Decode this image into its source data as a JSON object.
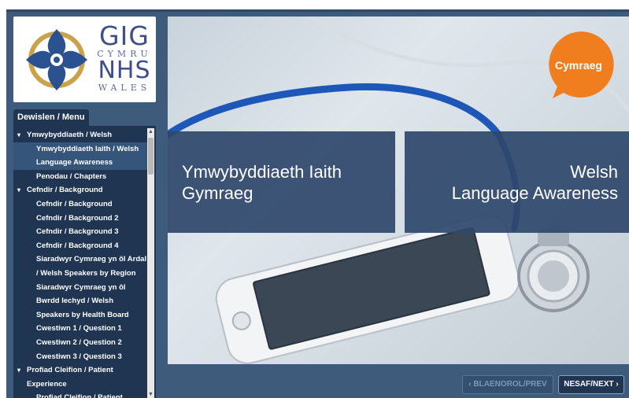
{
  "logo": {
    "line1": "GIG",
    "line2": "CYMRU",
    "line3": "NHS",
    "line4": "WALES"
  },
  "menu": {
    "tab_label": "Dewislen / Menu",
    "items": [
      {
        "label": "Ymwybyddiaeth / Welsh",
        "caret": "▾"
      },
      {
        "label": "Ymwybyddiaeth Iaith / Welsh"
      },
      {
        "label": "Language Awareness"
      },
      {
        "label": "Penodau / Chapters"
      },
      {
        "label": "Cefndir / Background",
        "caret": "▾"
      },
      {
        "label": "Cefndir / Background"
      },
      {
        "label": "Cefndir / Background 2"
      },
      {
        "label": "Cefndir / Background 3"
      },
      {
        "label": "Cefndir / Background 4"
      },
      {
        "label": "Siaradwyr Cymraeg yn ôl Ardal"
      },
      {
        "label": "/ Welsh Speakers by Region"
      },
      {
        "label": "Siaradwyr Cymraeg yn ôl"
      },
      {
        "label": "Bwrdd Iechyd / Welsh"
      },
      {
        "label": "Speakers by Health Board"
      },
      {
        "label": "Cwestiwn 1 / Question 1"
      },
      {
        "label": "Cwestiwn 2 / Question 2"
      },
      {
        "label": "Cwestiwn 3 / Question 3"
      },
      {
        "label": "Profiad Cleifion / Patient",
        "caret": "▾"
      },
      {
        "label": "Experience"
      },
      {
        "label": "Profiad Cleifion / Patient"
      }
    ],
    "scroll_up": "▲",
    "scroll_down": "▼"
  },
  "slide": {
    "badge": "Cymraeg",
    "title_welsh_line1": "Ymwybyddiaeth Iaith",
    "title_welsh_line2": "Gymraeg",
    "title_english_line1": "Welsh",
    "title_english_line2": "Language Awareness"
  },
  "nav": {
    "prev_label": "‹ BLAENOROL/PREV",
    "next_label": "NESAF/NEXT ›"
  },
  "colors": {
    "frame": "#3e5b7b",
    "menu_bg": "#1f3552",
    "badge": "#f07d1e",
    "title_box": "#2f486c"
  }
}
